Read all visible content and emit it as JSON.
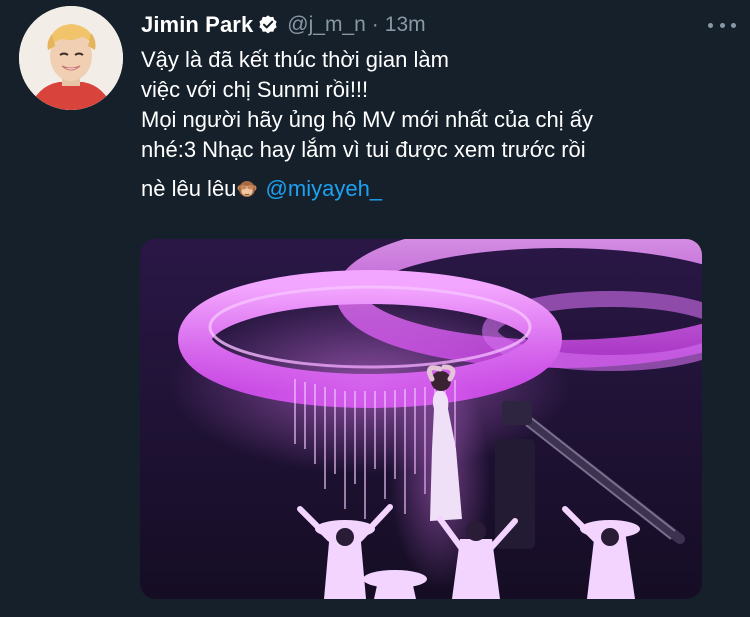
{
  "tweet": {
    "display_name": "Jimin Park",
    "handle": "@j_m_n",
    "separator": "·",
    "time": "13m",
    "lines": [
      "Vậy là đã kết thúc thời gian làm",
      "việc với chị Sunmi rồi!!!",
      "Mọi người hãy ủng hộ MV mới nhất của chị ấy",
      "nhé:3 Nhạc hay lắm vì tui được xem trước rồi"
    ],
    "last_line_text": "nè lêu lêu",
    "mention": "@miyayeh_"
  },
  "icons": {
    "verified": "verified-badge-icon",
    "more": "more-options-icon",
    "emoji": "see-no-evil-monkey-emoji"
  },
  "colors": {
    "background": "#15202b",
    "text": "#ffffff",
    "secondary_text": "#8899a6",
    "link": "#1da1f2",
    "media_accent": "#d34fe6"
  }
}
